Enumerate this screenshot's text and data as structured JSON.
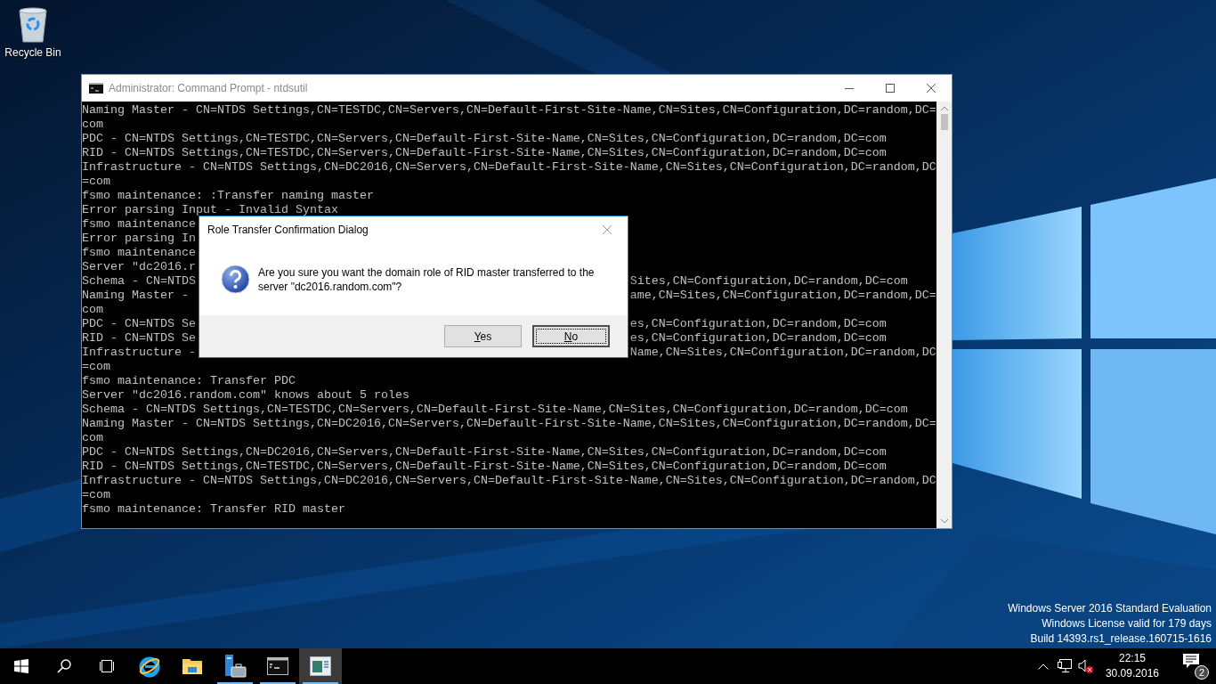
{
  "desktop_icons": [
    {
      "label": "Recycle Bin"
    }
  ],
  "console": {
    "title": "Administrator: Command Prompt - ntdsutil",
    "lines": [
      {
        "kind": "full",
        "text": "Naming Master - CN=NTDS Settings,CN=TESTDC,CN=Servers,CN=Default-First-Site-Name,CN=Sites,CN=Configuration,DC=random,DC="
      },
      {
        "kind": "full",
        "text": "com"
      },
      {
        "kind": "full",
        "text": "PDC - CN=NTDS Settings,CN=TESTDC,CN=Servers,CN=Default-First-Site-Name,CN=Sites,CN=Configuration,DC=random,DC=com"
      },
      {
        "kind": "full",
        "text": "RID - CN=NTDS Settings,CN=TESTDC,CN=Servers,CN=Default-First-Site-Name,CN=Sites,CN=Configuration,DC=random,DC=com"
      },
      {
        "kind": "full",
        "text": "Infrastructure - CN=NTDS Settings,CN=DC2016,CN=Servers,CN=Default-First-Site-Name,CN=Sites,CN=Configuration,DC=random,DC"
      },
      {
        "kind": "full",
        "text": "=com"
      },
      {
        "kind": "full",
        "text": "fsmo maintenance: :Transfer naming master"
      },
      {
        "kind": "full",
        "text": "Error parsing Input - Invalid Syntax"
      },
      {
        "kind": "split",
        "left": "fsmo maintenance"
      },
      {
        "kind": "split",
        "left": "Error parsing In"
      },
      {
        "kind": "split",
        "left": "fsmo maintenance"
      },
      {
        "kind": "split",
        "left": "Server \"dc2016.r"
      },
      {
        "kind": "split",
        "left": "Schema - CN=NTDS",
        "right": "Sites,CN=Configuration,DC=random,DC=com"
      },
      {
        "kind": "split",
        "left": "Naming Master - ",
        "right": "ame,CN=Sites,CN=Configuration,DC=random,DC="
      },
      {
        "kind": "split",
        "left": "com"
      },
      {
        "kind": "split",
        "left": "PDC - CN=NTDS Se",
        "right": "es,CN=Configuration,DC=random,DC=com"
      },
      {
        "kind": "split",
        "left": "RID - CN=NTDS Se",
        "right": "es,CN=Configuration,DC=random,DC=com"
      },
      {
        "kind": "split",
        "left": "Infrastructure -",
        "right": "Name,CN=Sites,CN=Configuration,DC=random,DC"
      },
      {
        "kind": "full",
        "text": "=com"
      },
      {
        "kind": "full",
        "text": "fsmo maintenance: Transfer PDC"
      },
      {
        "kind": "full",
        "text": "Server \"dc2016.random.com\" knows about 5 roles"
      },
      {
        "kind": "full",
        "text": "Schema - CN=NTDS Settings,CN=TESTDC,CN=Servers,CN=Default-First-Site-Name,CN=Sites,CN=Configuration,DC=random,DC=com"
      },
      {
        "kind": "full",
        "text": "Naming Master - CN=NTDS Settings,CN=DC2016,CN=Servers,CN=Default-First-Site-Name,CN=Sites,CN=Configuration,DC=random,DC="
      },
      {
        "kind": "full",
        "text": "com"
      },
      {
        "kind": "full",
        "text": "PDC - CN=NTDS Settings,CN=DC2016,CN=Servers,CN=Default-First-Site-Name,CN=Sites,CN=Configuration,DC=random,DC=com"
      },
      {
        "kind": "full",
        "text": "RID - CN=NTDS Settings,CN=TESTDC,CN=Servers,CN=Default-First-Site-Name,CN=Sites,CN=Configuration,DC=random,DC=com"
      },
      {
        "kind": "full",
        "text": "Infrastructure - CN=NTDS Settings,CN=DC2016,CN=Servers,CN=Default-First-Site-Name,CN=Sites,CN=Configuration,DC=random,DC"
      },
      {
        "kind": "full",
        "text": "=com"
      },
      {
        "kind": "full",
        "text": "fsmo maintenance: Transfer RID master"
      }
    ]
  },
  "dialog": {
    "title": "Role Transfer Confirmation Dialog",
    "message": "Are you sure you want the domain role of RID master transferred to the server \"dc2016.random.com\"?",
    "buttons": [
      {
        "label": "Yes",
        "selected": false
      },
      {
        "label": "No",
        "selected": true
      }
    ]
  },
  "build_info": [
    "Windows Server 2016 Standard Evaluation",
    "Windows License valid for 179 days",
    "Build 14393.rs1_release.160715-1616"
  ],
  "taskbar": {
    "apps": [
      {
        "kind": "ie",
        "running": false,
        "selected": false
      },
      {
        "kind": "explorer",
        "running": false,
        "selected": false
      },
      {
        "kind": "server-manager",
        "running": true,
        "selected": false
      },
      {
        "kind": "cmd",
        "running": true,
        "selected": false
      },
      {
        "kind": "app-window",
        "running": true,
        "selected": true
      }
    ],
    "clock": {
      "time": "22:15",
      "date": "30.09.2016"
    },
    "notification_count": "2"
  }
}
